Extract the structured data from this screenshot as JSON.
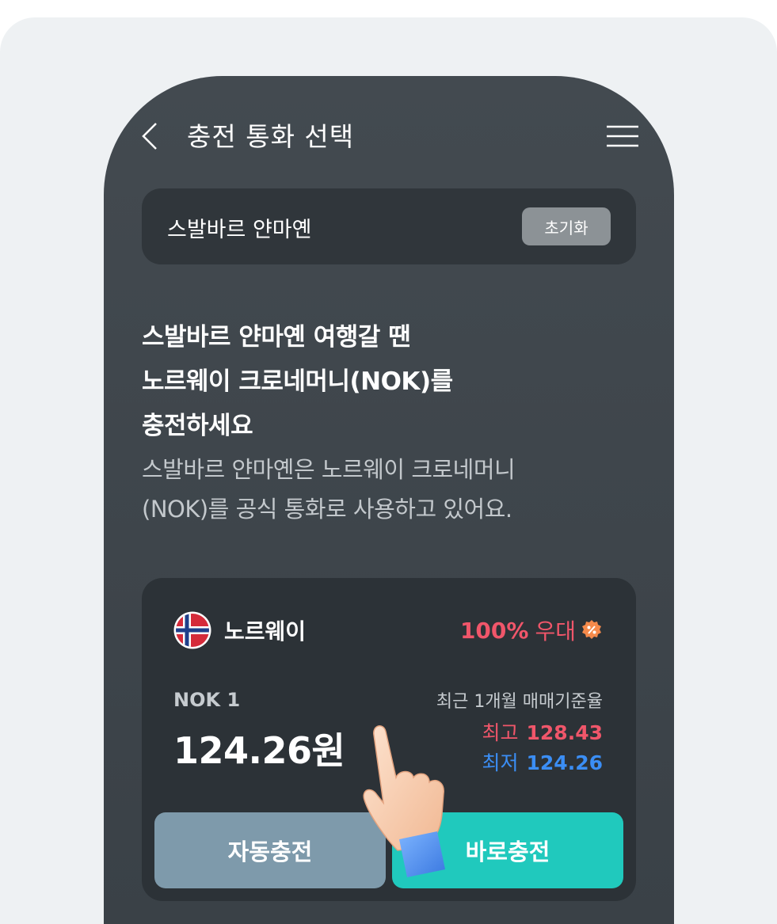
{
  "header": {
    "title": "충전 통화 선택"
  },
  "search": {
    "value": "스발바르 얀마옌",
    "reset_label": "초기화"
  },
  "intro": {
    "headline_lines": [
      "스발바르 얀마옌 여행갈 땐",
      "노르웨이 크로네머니(NOK)를",
      "충전하세요"
    ],
    "sub_lines": [
      "스발바르 얀마옌은 노르웨이 크로네머니",
      "(NOK)를 공식 통화로 사용하고 있어요."
    ]
  },
  "rate_card": {
    "country": "노르웨이",
    "discount_rate": "100%",
    "discount_label": "우대",
    "unit": "NOK 1",
    "price": "124.26원",
    "rate_caption": "최근 1개월 매매기준율",
    "high_label": "최고",
    "high_value": "128.43",
    "low_label": "최저",
    "low_value": "124.26",
    "auto_button": "자동충전",
    "now_button": "바로충전"
  },
  "colors": {
    "accent_teal": "#20c9bd",
    "button_gray": "#7e9aab",
    "high_red": "#f0566a",
    "low_blue": "#3b8ef5"
  },
  "icons": [
    "back-arrow-icon",
    "menu-icon",
    "norway-flag-icon",
    "discount-badge-icon",
    "pointing-hand-icon"
  ]
}
